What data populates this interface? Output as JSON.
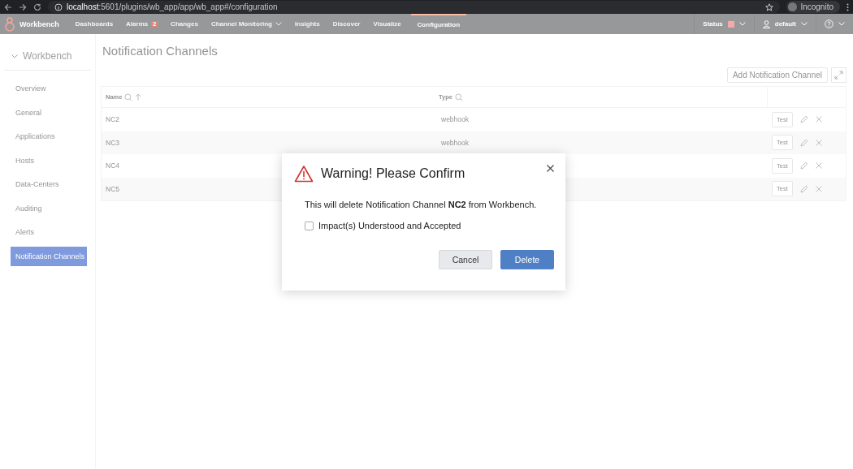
{
  "browser": {
    "host": "localhost",
    "path": ":5601/plugins/wb_app/app/wb_app#/configuration",
    "profile": "Incognito"
  },
  "nav": {
    "brand": "Workbench",
    "tabs": [
      {
        "label": "Dashboards",
        "selected": false
      },
      {
        "label": "Alarms",
        "selected": false,
        "badge": "2"
      },
      {
        "label": "Changes",
        "selected": false
      },
      {
        "label": "Channel Monitoring",
        "selected": false,
        "dropdown": true
      },
      {
        "label": "Insights",
        "selected": false
      },
      {
        "label": "Discover",
        "selected": false
      },
      {
        "label": "Visualize",
        "selected": false
      },
      {
        "label": "Configuration",
        "selected": true
      }
    ],
    "status": {
      "label": "Status",
      "color": "#f7a8a8"
    },
    "user": "default"
  },
  "sidebar": {
    "title": "Workbench",
    "items": [
      {
        "label": "Overview",
        "selected": false
      },
      {
        "label": "General",
        "selected": false
      },
      {
        "label": "Applications",
        "selected": false
      },
      {
        "label": "Hosts",
        "selected": false
      },
      {
        "label": "Data-Centers",
        "selected": false
      },
      {
        "label": "Auditing",
        "selected": false
      },
      {
        "label": "Alerts",
        "selected": false
      },
      {
        "label": "Notification Channels",
        "selected": true
      }
    ]
  },
  "page": {
    "title": "Notification Channels",
    "add_button": "Add Notification Channel"
  },
  "table": {
    "columns": [
      {
        "label": "Name",
        "sorted": true
      },
      {
        "label": "Type",
        "sorted": false
      }
    ],
    "rows": [
      {
        "name": "NC2",
        "type": "webhook",
        "test": "Test"
      },
      {
        "name": "NC3",
        "type": "webhook",
        "test": "Test"
      },
      {
        "name": "NC4",
        "test": "Test"
      },
      {
        "name": "NC5",
        "test": "Test"
      }
    ]
  },
  "dialog": {
    "title": "Warning! Please Confirm",
    "message": "This will delete Notification Channel **NC2** from Workbench.",
    "checkbox": {
      "label": "Impact(s) Understood and Accepted",
      "checked": false
    },
    "buttons": [
      {
        "label": "Cancel",
        "kind": "secondary"
      },
      {
        "label": "Delete",
        "kind": "primary"
      }
    ]
  }
}
